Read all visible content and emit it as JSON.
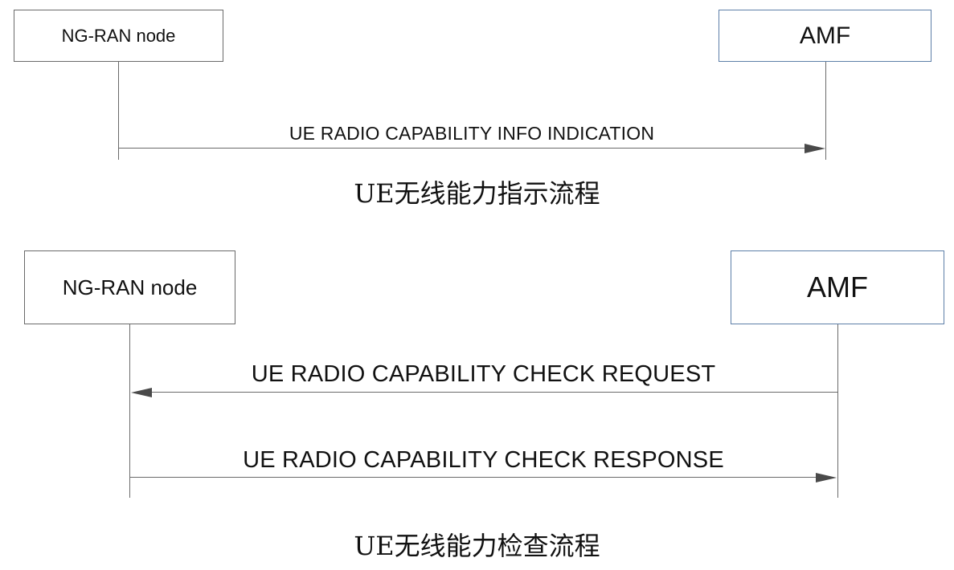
{
  "diagrams": [
    {
      "left_node": "NG-RAN node",
      "right_node": "AMF",
      "messages": [
        {
          "label": "UE RADIO CAPABILITY INFO INDICATION",
          "direction": "right"
        }
      ],
      "caption": "UE无线能力指示流程"
    },
    {
      "left_node": "NG-RAN node",
      "right_node": "AMF",
      "messages": [
        {
          "label": "UE RADIO CAPABILITY CHECK REQUEST",
          "direction": "left"
        },
        {
          "label": "UE RADIO CAPABILITY CHECK RESPONSE",
          "direction": "right"
        }
      ],
      "caption": "UE无线能力检查流程"
    }
  ],
  "colors": {
    "line": "#6a6a6a",
    "arrowhead": "#4a4a4a",
    "amf_border": "#5d7fa8"
  }
}
